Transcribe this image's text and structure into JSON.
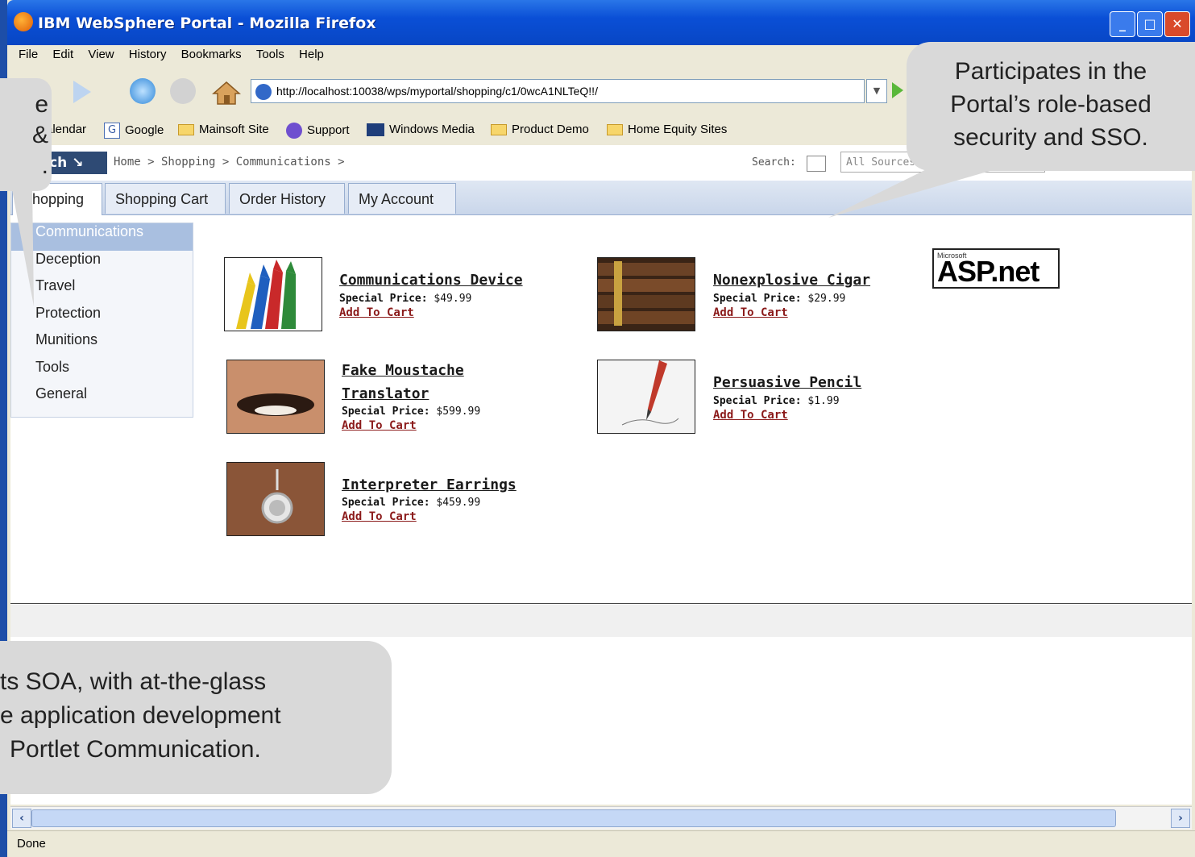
{
  "window": {
    "title": "IBM WebSphere Portal - Mozilla Firefox"
  },
  "menu": [
    "File",
    "Edit",
    "View",
    "History",
    "Bookmarks",
    "Tools",
    "Help"
  ],
  "address": {
    "url": "http://localhost:10038/wps/myportal/shopping/c1/0wcA1NLTeQ!!/"
  },
  "bookmarks": [
    "alendar",
    "Google",
    "Mainsoft Site",
    "Support",
    "Windows Media",
    "Product Demo",
    "Home Equity Sites"
  ],
  "portal": {
    "launch_label": "nch",
    "breadcrumb": "Home > Shopping > Communications >",
    "search_label": "Search:",
    "search_sources": "All Sources"
  },
  "tabs": [
    "Shopping",
    "Shopping Cart",
    "Order History",
    "My Account"
  ],
  "categories": [
    "Communications",
    "Deception",
    "Travel",
    "Protection",
    "Munitions",
    "Tools",
    "General"
  ],
  "price_label": "Special Price:",
  "add_label": "Add To Cart",
  "products": [
    {
      "name_line1": "Communications Device",
      "name_line2": "",
      "price": "$49.99"
    },
    {
      "name_line1": "Nonexplosive Cigar",
      "name_line2": "",
      "price": "$29.99"
    },
    {
      "name_line1": "Fake Moustache",
      "name_line2": "Translator",
      "price": "$599.99"
    },
    {
      "name_line1": "Persuasive Pencil",
      "name_line2": "",
      "price": "$1.99"
    },
    {
      "name_line1": "Interpreter Earrings",
      "name_line2": "",
      "price": "$459.99"
    }
  ],
  "logo": {
    "small": "Microsoft",
    "big": "ASP.net"
  },
  "status": {
    "text": "Done"
  },
  "callouts": {
    "left": [
      "e",
      "&",
      "."
    ],
    "right": [
      "Participates in the",
      "Portal’s role-based",
      "security and SSO."
    ],
    "bottom": [
      "ts SOA, with at-the-glass",
      "e application development",
      "Portlet Communication."
    ]
  }
}
